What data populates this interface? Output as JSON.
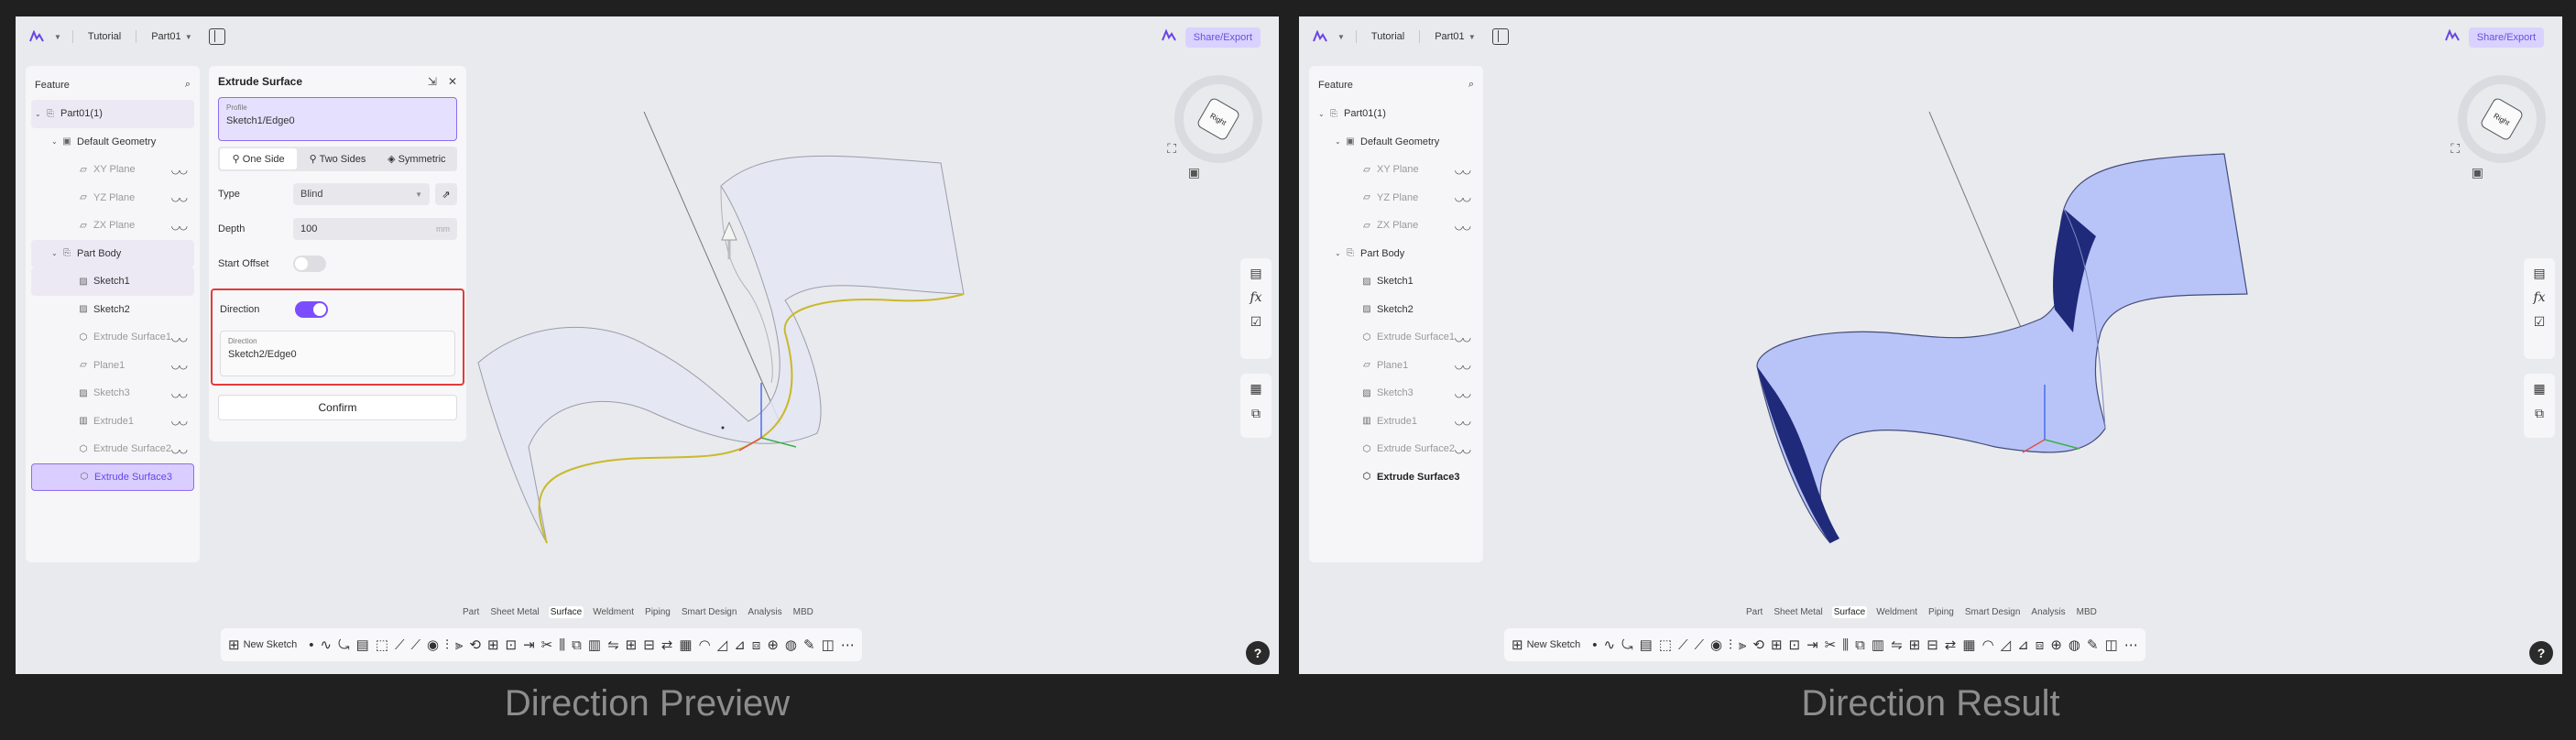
{
  "colors": {
    "accent": "#7c4dff",
    "highlight_border": "#e23b3b",
    "surface_preview": "#e4e6f2",
    "surface_result": "#b8c4f8",
    "edge_selected": "#c9b92a"
  },
  "panels": [
    {
      "id": "left",
      "caption": "Direction Preview",
      "topbar": {
        "project": "Tutorial",
        "part": "Part01"
      },
      "share_label": "Share/Export",
      "feature_tree": {
        "title": "Feature",
        "items": [
          {
            "label": "Part01(1)",
            "level": 0,
            "arrow": "v",
            "icon": "part-icon",
            "state": "sel",
            "eye": false
          },
          {
            "label": "Default Geometry",
            "level": 1,
            "arrow": "v",
            "icon": "geometry-icon",
            "state": "normal",
            "eye": false
          },
          {
            "label": "XY Plane",
            "level": 2,
            "arrow": "",
            "icon": "plane-icon",
            "state": "dim",
            "eye": true
          },
          {
            "label": "YZ Plane",
            "level": 2,
            "arrow": "",
            "icon": "plane-icon",
            "state": "dim",
            "eye": true
          },
          {
            "label": "ZX Plane",
            "level": 2,
            "arrow": "",
            "icon": "plane-icon",
            "state": "dim",
            "eye": true
          },
          {
            "label": "Part Body",
            "level": 1,
            "arrow": "v",
            "icon": "body-icon",
            "state": "sel",
            "eye": false
          },
          {
            "label": "Sketch1",
            "level": 2,
            "arrow": "",
            "icon": "sketch-icon",
            "state": "sel",
            "eye": false
          },
          {
            "label": "Sketch2",
            "level": 2,
            "arrow": "",
            "icon": "sketch-icon",
            "state": "normal",
            "eye": false
          },
          {
            "label": "Extrude Surface1",
            "level": 2,
            "arrow": "",
            "icon": "surface-icon",
            "state": "dim",
            "eye": true
          },
          {
            "label": "Plane1",
            "level": 2,
            "arrow": "",
            "icon": "plane-icon",
            "state": "dim",
            "eye": true
          },
          {
            "label": "Sketch3",
            "level": 2,
            "arrow": "",
            "icon": "sketch-icon",
            "state": "dim",
            "eye": true
          },
          {
            "label": "Extrude1",
            "level": 2,
            "arrow": "",
            "icon": "extrude-icon",
            "state": "dim",
            "eye": true
          },
          {
            "label": "Extrude Surface2",
            "level": 2,
            "arrow": "",
            "icon": "surface-icon",
            "state": "dim",
            "eye": true
          },
          {
            "label": "Extrude Surface3",
            "level": 2,
            "arrow": "",
            "icon": "surface-icon",
            "state": "active",
            "eye": false
          }
        ]
      },
      "extrude_panel": {
        "title": "Extrude Surface",
        "profile_label": "Profile",
        "profile_value": "Sketch1/Edge0",
        "tabs": [
          "One Side",
          "Two Sides",
          "Symmetric"
        ],
        "type_label": "Type",
        "type_value": "Blind",
        "depth_label": "Depth",
        "depth_value": "100",
        "depth_unit": "mm",
        "start_offset_label": "Start Offset",
        "start_offset_on": false,
        "direction_label": "Direction",
        "direction_on": true,
        "direction_field_label": "Direction",
        "direction_field_value": "Sketch2/Edge0",
        "confirm_label": "Confirm"
      },
      "module_tabs": [
        "Part",
        "Sheet Metal",
        "Surface",
        "Weldment",
        "Piping",
        "Smart Design",
        "Analysis",
        "MBD"
      ],
      "module_active": "Surface",
      "toolbar_new_sketch": "New Sketch",
      "view_cube_face": "Right",
      "help": "?"
    },
    {
      "id": "right",
      "caption": "Direction Result",
      "topbar": {
        "project": "Tutorial",
        "part": "Part01"
      },
      "share_label": "Share/Export",
      "feature_tree": {
        "title": "Feature",
        "items": [
          {
            "label": "Part01(1)",
            "level": 0,
            "arrow": "v",
            "icon": "part-icon",
            "state": "normal",
            "eye": false
          },
          {
            "label": "Default Geometry",
            "level": 1,
            "arrow": "v",
            "icon": "geometry-icon",
            "state": "normal",
            "eye": false
          },
          {
            "label": "XY Plane",
            "level": 2,
            "arrow": "",
            "icon": "plane-icon",
            "state": "dim",
            "eye": true
          },
          {
            "label": "YZ Plane",
            "level": 2,
            "arrow": "",
            "icon": "plane-icon",
            "state": "dim",
            "eye": true
          },
          {
            "label": "ZX Plane",
            "level": 2,
            "arrow": "",
            "icon": "plane-icon",
            "state": "dim",
            "eye": true
          },
          {
            "label": "Part Body",
            "level": 1,
            "arrow": "v",
            "icon": "body-icon",
            "state": "normal",
            "eye": false
          },
          {
            "label": "Sketch1",
            "level": 2,
            "arrow": "",
            "icon": "sketch-icon",
            "state": "normal",
            "eye": false
          },
          {
            "label": "Sketch2",
            "level": 2,
            "arrow": "",
            "icon": "sketch-icon",
            "state": "normal",
            "eye": false
          },
          {
            "label": "Extrude Surface1",
            "level": 2,
            "arrow": "",
            "icon": "surface-icon",
            "state": "dim",
            "eye": true
          },
          {
            "label": "Plane1",
            "level": 2,
            "arrow": "",
            "icon": "plane-icon",
            "state": "dim",
            "eye": true
          },
          {
            "label": "Sketch3",
            "level": 2,
            "arrow": "",
            "icon": "sketch-icon",
            "state": "dim",
            "eye": true
          },
          {
            "label": "Extrude1",
            "level": 2,
            "arrow": "",
            "icon": "extrude-icon",
            "state": "dim",
            "eye": true
          },
          {
            "label": "Extrude Surface2",
            "level": 2,
            "arrow": "",
            "icon": "surface-icon",
            "state": "dim",
            "eye": true
          },
          {
            "label": "Extrude Surface3",
            "level": 2,
            "arrow": "",
            "icon": "surface-icon",
            "state": "bold",
            "eye": false
          }
        ]
      },
      "module_tabs": [
        "Part",
        "Sheet Metal",
        "Surface",
        "Weldment",
        "Piping",
        "Smart Design",
        "Analysis",
        "MBD"
      ],
      "module_active": "Surface",
      "toolbar_new_sketch": "New Sketch",
      "view_cube_face": "Right",
      "help": "?"
    }
  ]
}
